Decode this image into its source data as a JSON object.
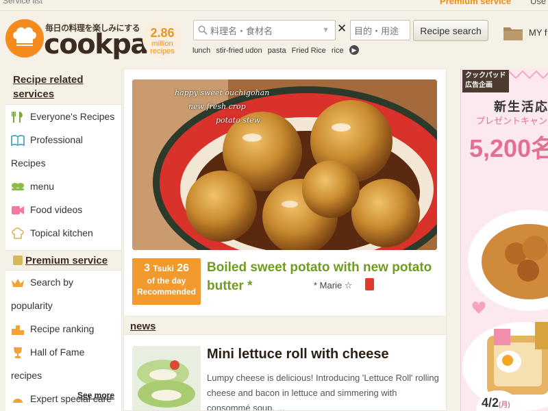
{
  "topbar": {
    "service_list": "Service list",
    "premium_service": "Premium service",
    "user": "Use"
  },
  "header": {
    "tagline": "毎日の料理を楽しみにする",
    "logo_text": "cookpad",
    "recipe_count": "2.86",
    "recipe_count_unit": "million",
    "recipe_count_label": "recipes",
    "search_placeholder": "料理名・食材名",
    "purpose_placeholder": "目的・用途",
    "search_button": "Recipe search",
    "clear_symbol": "✕",
    "keywords": [
      "lunch",
      "stir-fried udon",
      "pasta",
      "Fried Rice",
      "rice"
    ],
    "my_folder": "MY f"
  },
  "sidebar": {
    "related_heading": "Recipe related services",
    "items": [
      {
        "label": "Everyone's Recipes",
        "icon": "utensils-icon"
      },
      {
        "label": "Professional",
        "label2": "Recipes",
        "icon": "book-icon"
      },
      {
        "label": "menu",
        "icon": "menu-bowl-icon"
      },
      {
        "label": "Food videos",
        "icon": "video-icon"
      },
      {
        "label": "Topical kitchen",
        "icon": "chef-hat-icon"
      }
    ],
    "premium_heading": "Premium service",
    "premium_items": [
      {
        "label": "Search by",
        "label2": "popularity",
        "icon": "crown-icon"
      },
      {
        "label": "Recipe ranking",
        "icon": "ranking-icon"
      },
      {
        "label": "Hall of Fame",
        "label2": "recipes",
        "icon": "trophy-icon"
      },
      {
        "label": "Expert special care",
        "icon": "expert-icon"
      }
    ],
    "see_more": "See more"
  },
  "main": {
    "hero_caption_lines": [
      "happy sweet ouchigohan",
      "new fresh crop",
      "potato stew"
    ],
    "recommend": {
      "month": "3",
      "month_unit": "Tsuki",
      "day": "26",
      "line2": "of the day",
      "line3": "Recommended"
    },
    "recipe_title": "Boiled sweet potato with new potato butter *",
    "recipe_author": "* Marie ☆",
    "news_heading": "news",
    "news_title": "Mini lettuce roll with cheese",
    "news_body": "Lumpy cheese is delicious! Introducing 'Lettuce Roll' rolling cheese and bacon in lettuce and simmering with consommé soup. ..."
  },
  "ad": {
    "tag_line1": "クックパッド",
    "tag_line2": "広告企画",
    "title": "新生活応",
    "sub": "プレゼントキャン",
    "number": "5,200名",
    "date": "4/2",
    "date_day": "(月)"
  },
  "colors": {
    "brand_orange": "#f58b1f",
    "title_green": "#6f9c1f",
    "ad_pink": "#e56f90"
  }
}
